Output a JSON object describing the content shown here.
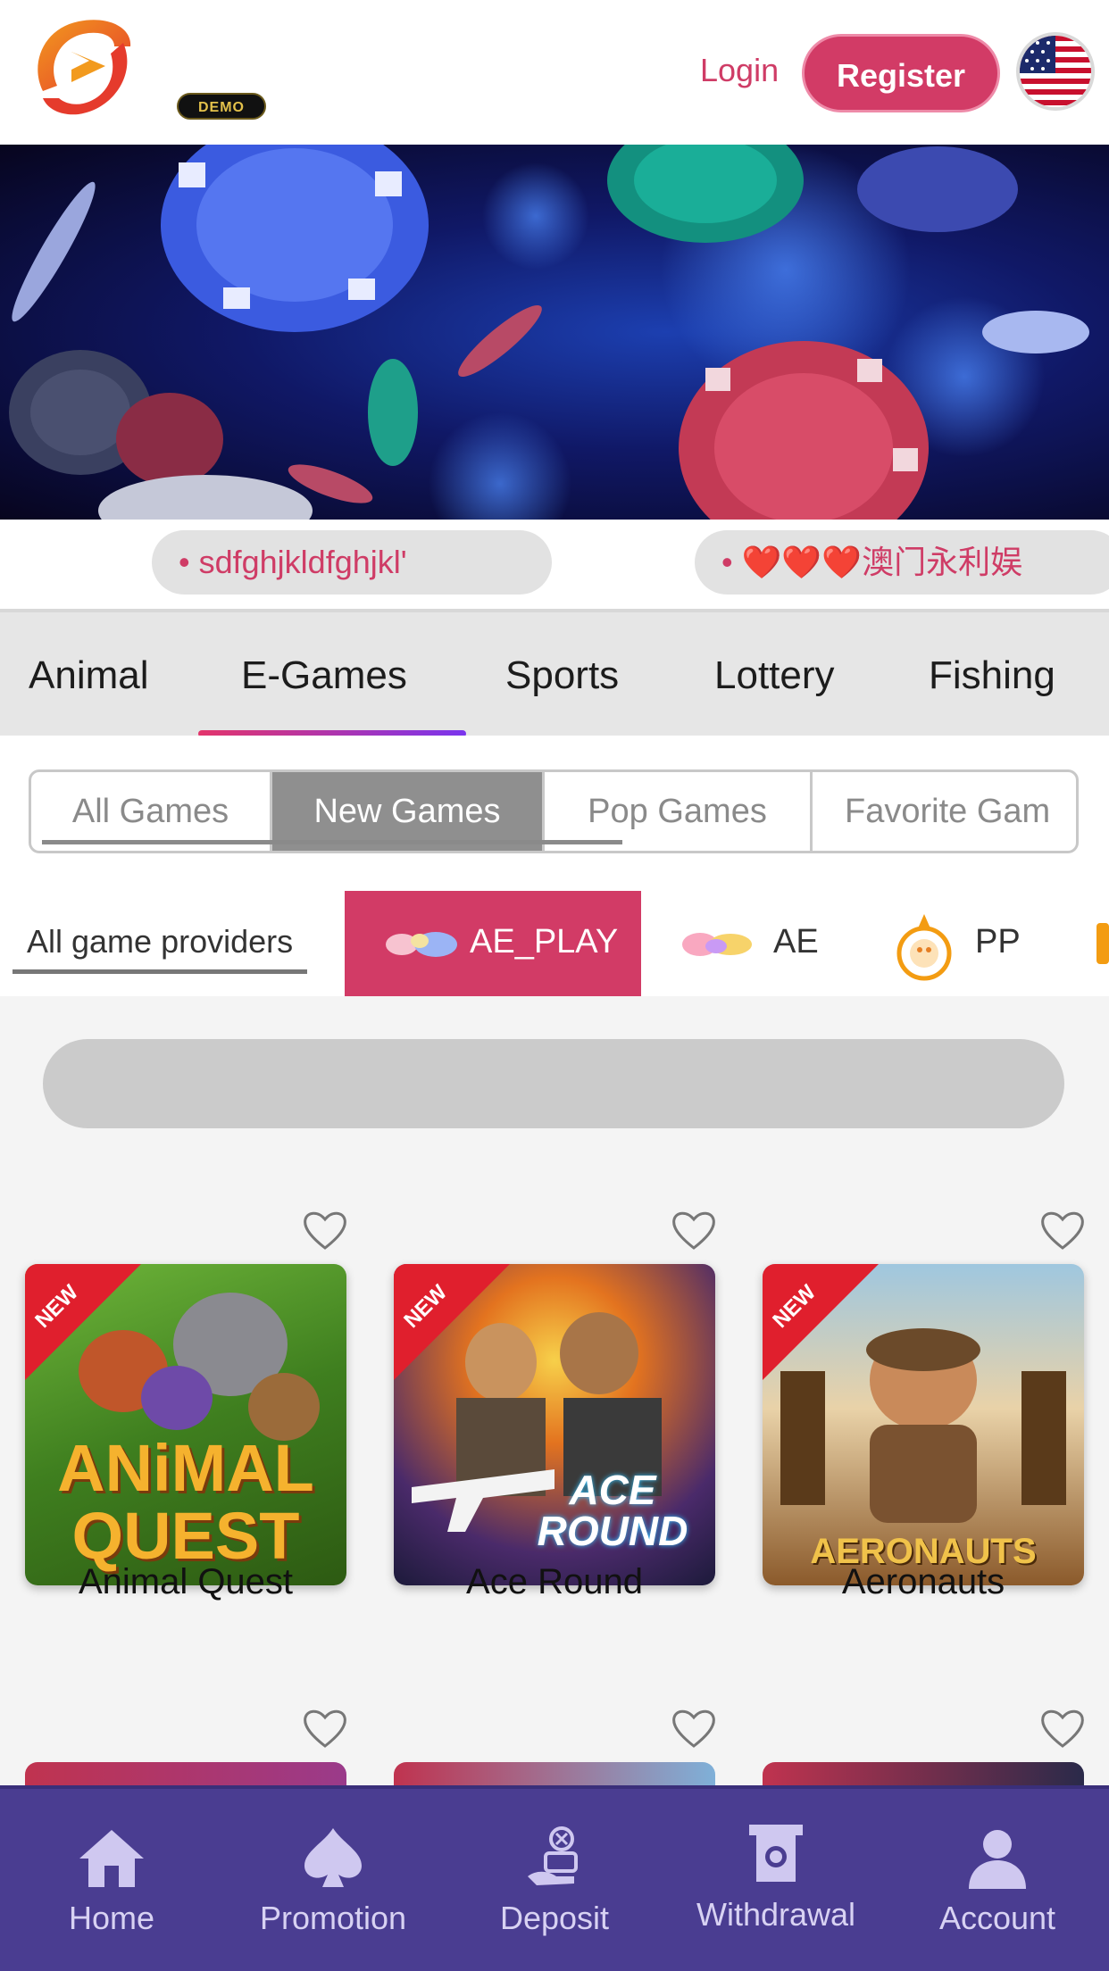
{
  "header": {
    "logo": "brand-logo",
    "demo_badge": "DEMO",
    "login_label": "Login",
    "register_label": "Register",
    "flag": "us-flag-icon"
  },
  "banner": {
    "image": "casino-chips-banner"
  },
  "marquee": {
    "items": [
      "• sdfghjkldfghjkl'",
      "• ❤️❤️❤️澳门永利娱"
    ]
  },
  "category_tabs": {
    "items": [
      "Animal",
      "E-Games",
      "Sports",
      "Lottery",
      "Fishing"
    ],
    "active": "E-Games"
  },
  "sub_tabs": {
    "items": [
      "All Games",
      "New Games",
      "Pop Games",
      "Favorite Gam"
    ],
    "active": "New Games"
  },
  "providers": {
    "all_label": "All game providers",
    "items": [
      "AE_PLAY",
      "AE",
      "PP"
    ],
    "active": "AE_PLAY"
  },
  "games": {
    "badge": "NEW",
    "row1": [
      {
        "name": "Animal Quest",
        "art_line1": "ANiMAL",
        "art_line2": "QUEST"
      },
      {
        "name": "Ace Round",
        "art_line1": "ACE",
        "art_line2": "ROUND"
      },
      {
        "name": "Aeronauts",
        "art_line1": "AERONAUTS",
        "art_line2": ""
      }
    ]
  },
  "bottom_nav": {
    "items": [
      "Home",
      "Promotion",
      "Deposit",
      "Withdrawal",
      "Account"
    ]
  },
  "colors": {
    "brand_pink": "#d23b66",
    "nav_purple": "#4a3d91",
    "tab_gradient_start": "#e3356b",
    "tab_gradient_end": "#7a35ee"
  }
}
